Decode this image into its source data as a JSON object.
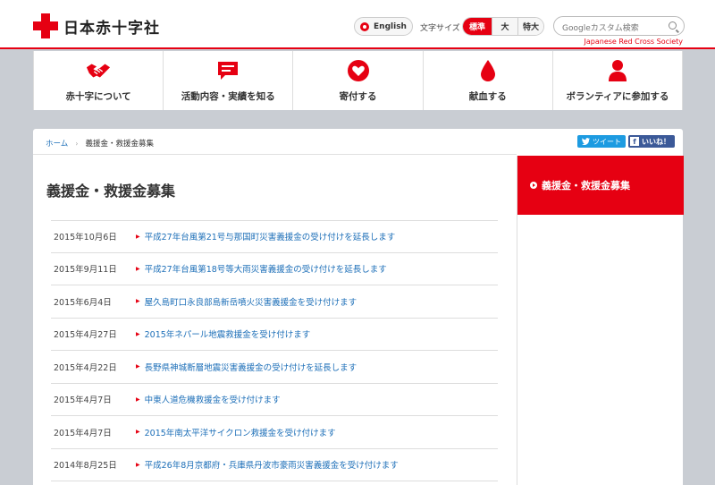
{
  "header": {
    "logo_text": "日本赤十字社",
    "english_label": "English",
    "font_size_label": "文字サイズ",
    "font_sizes": [
      "標準",
      "大",
      "特大"
    ],
    "search_placeholder": "Googleカスタム検索",
    "tagline": "Japanese Red Cross Society"
  },
  "nav": [
    {
      "label": "赤十字について",
      "icon": "handshake-icon"
    },
    {
      "label": "活動内容・実績を知る",
      "icon": "speech-bubble-icon"
    },
    {
      "label": "寄付する",
      "icon": "heart-icon"
    },
    {
      "label": "献血する",
      "icon": "blood-drop-icon"
    },
    {
      "label": "ボランティアに参加する",
      "icon": "person-icon"
    }
  ],
  "breadcrumb": {
    "home": "ホーム",
    "current": "義援金・救援金募集"
  },
  "share": {
    "tweet": "ツイート",
    "like": "いいね！"
  },
  "page_title": "義援金・救援金募集",
  "news": [
    {
      "date": "2015年10月6日",
      "title": "平成27年台風第21号与那国町災害義援金の受け付けを延長します"
    },
    {
      "date": "2015年9月11日",
      "title": "平成27年台風第18号等大雨災害義援金の受け付けを延長します"
    },
    {
      "date": "2015年6月4日",
      "title": "屋久島町口永良部島新岳噴火災害義援金を受け付けます"
    },
    {
      "date": "2015年4月27日",
      "title": "2015年ネパール地震救援金を受け付けます"
    },
    {
      "date": "2015年4月22日",
      "title": "長野県神城断層地震災害義援金の受け付けを延長します"
    },
    {
      "date": "2015年4月7日",
      "title": "中東人道危機救援金を受け付けます"
    },
    {
      "date": "2015年4月7日",
      "title": "2015年南太平洋サイクロン救援金を受け付けます"
    },
    {
      "date": "2014年8月25日",
      "title": "平成26年8月京都府・兵庫県丹波市豪雨災害義援金を受け付けます"
    }
  ],
  "sidebar": {
    "active_label": "義援金・救援金募集"
  },
  "colors": {
    "brand_red": "#e60012",
    "link_blue": "#1d6fb8",
    "background": "#c9cdd3"
  }
}
